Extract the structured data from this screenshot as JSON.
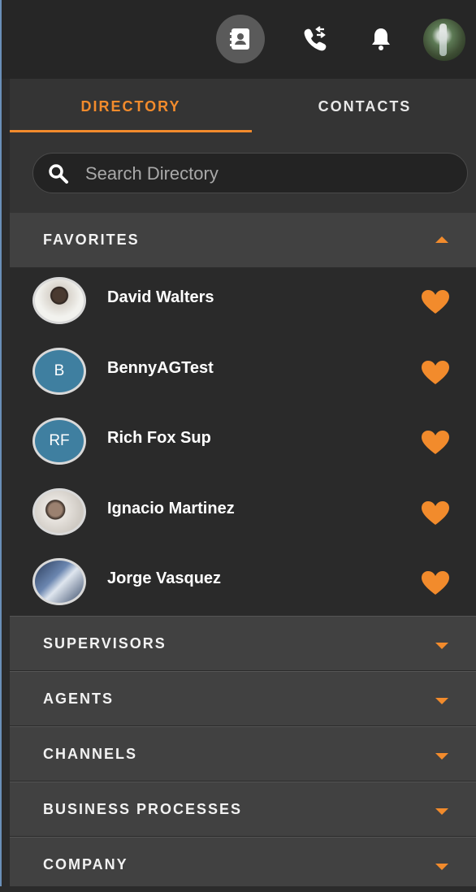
{
  "topbar": {
    "icons": [
      "contacts-book-icon",
      "phone-transfer-icon",
      "bell-icon"
    ],
    "active_icon": "contacts-book-icon"
  },
  "tabs": [
    {
      "label": "DIRECTORY",
      "active": true
    },
    {
      "label": "CONTACTS",
      "active": false
    }
  ],
  "search": {
    "placeholder": "Search Directory",
    "value": ""
  },
  "sections": {
    "favorites": {
      "label": "FAVORITES",
      "expanded": true
    },
    "supervisors": {
      "label": "SUPERVISORS",
      "expanded": false
    },
    "agents": {
      "label": "AGENTS",
      "expanded": false
    },
    "channels": {
      "label": "CHANNELS",
      "expanded": false
    },
    "business_processes": {
      "label": "BUSINESS PROCESSES",
      "expanded": false
    },
    "company": {
      "label": "COMPANY",
      "expanded": false
    }
  },
  "favorites": [
    {
      "name": "David Walters",
      "avatar": "photo",
      "initials": ""
    },
    {
      "name": "BennyAGTest",
      "avatar": "initials",
      "initials": "B"
    },
    {
      "name": "Rich Fox Sup",
      "avatar": "initials",
      "initials": "RF"
    },
    {
      "name": "Ignacio Martinez",
      "avatar": "photo",
      "initials": ""
    },
    {
      "name": "Jorge Vasquez",
      "avatar": "photo",
      "initials": ""
    }
  ],
  "colors": {
    "accent": "#f28b2c",
    "background": "#2b2b2b",
    "section": "#414141",
    "initials_avatar": "#3f7fa0"
  }
}
